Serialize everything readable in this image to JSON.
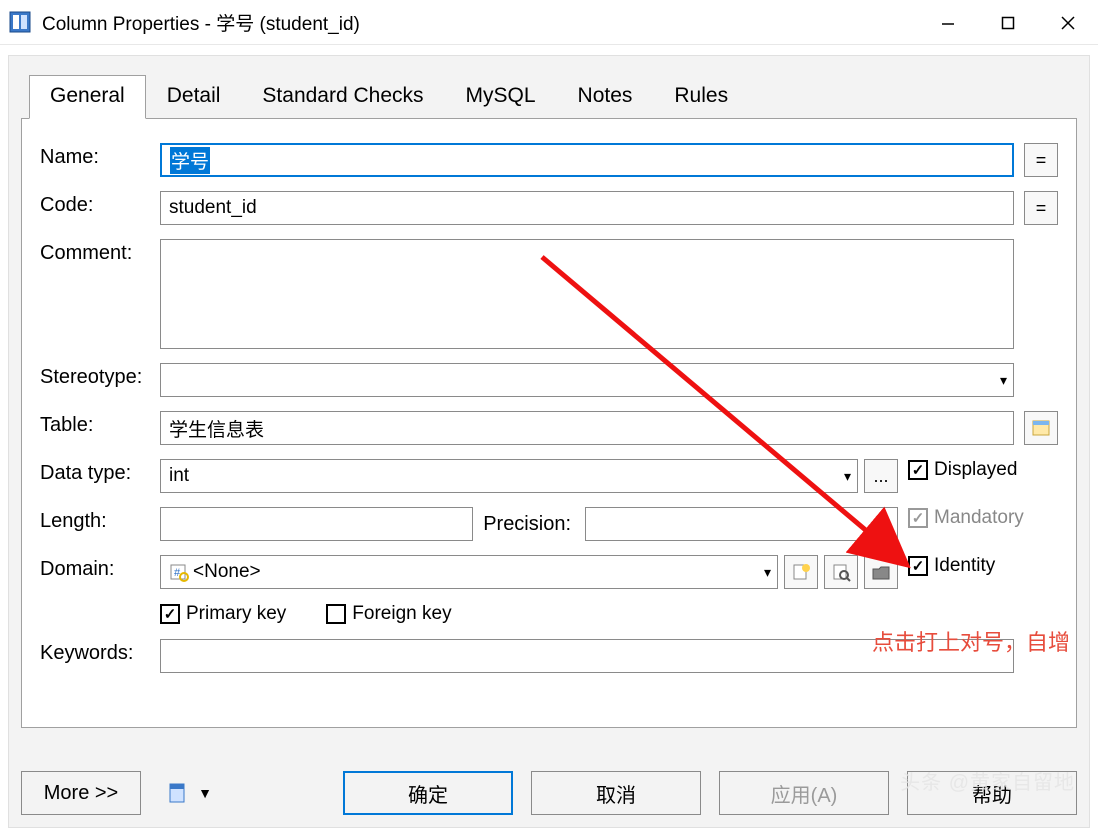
{
  "title": "Column Properties - 学号 (student_id)",
  "tabs": [
    "General",
    "Detail",
    "Standard Checks",
    "MySQL",
    "Notes",
    "Rules"
  ],
  "labels": {
    "name": "Name:",
    "code": "Code:",
    "comment": "Comment:",
    "stereotype": "Stereotype:",
    "table": "Table:",
    "datatype": "Data type:",
    "length": "Length:",
    "precision": "Precision:",
    "domain": "Domain:",
    "keywords": "Keywords:"
  },
  "fields": {
    "name": "学号",
    "code": "student_id",
    "comment": "",
    "stereotype": "",
    "table": "学生信息表",
    "datatype": "int",
    "length": "",
    "precision": "",
    "domain": "<None>",
    "keywords": ""
  },
  "sideBtn": {
    "equals": "=",
    "dots": "..."
  },
  "checks": {
    "displayed": {
      "label": "Displayed",
      "checked": true
    },
    "mandatory": {
      "label": "Mandatory",
      "checked": true,
      "disabled": true
    },
    "identity": {
      "label": "Identity",
      "checked": true
    },
    "primarykey": {
      "label": "Primary key",
      "checked": true
    },
    "foreignkey": {
      "label": "Foreign key",
      "checked": false
    }
  },
  "buttons": {
    "more": "More >>",
    "ok": "确定",
    "cancel": "取消",
    "apply": "应用(A)",
    "help": "帮助"
  },
  "annotation": "点击打上对号，自增",
  "watermark": "头条 @黄家自留地"
}
